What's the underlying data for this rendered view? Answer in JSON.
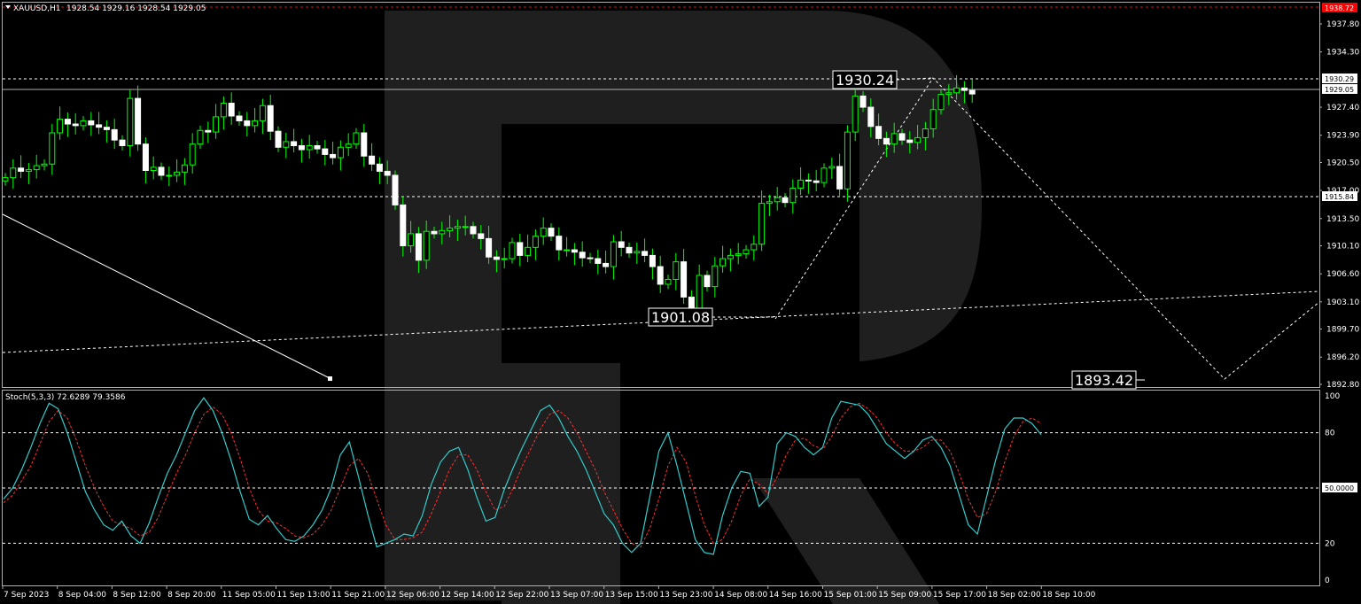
{
  "header": {
    "symbol": "XAUUSD,H1",
    "ohlc": "1928.54 1929.16 1928.54 1929.05"
  },
  "price_levels": {
    "red_line": "1938.72",
    "dotted_upper": "1930.29",
    "current": "1929.05",
    "dotted_mid": "1915.84"
  },
  "annotations": {
    "high_label": "1930.24",
    "low_label": "1901.08",
    "target_label": "1893.42"
  },
  "stoch_panel": {
    "title": "Stoch(5,3,3) 72.6289 79.3586",
    "levels": [
      "100",
      "80",
      "50.0000",
      "20",
      "0"
    ]
  },
  "colors": {
    "bull": "#00ff00",
    "bear_body": "#ffffff",
    "stoch_main": "#33cccc",
    "stoch_signal": "#ff3030",
    "red_line": "#ff0000",
    "watermark": "#2e2e2e"
  },
  "chart_data": [
    {
      "type": "candlestick",
      "title": "XAUUSD,H1",
      "ylim": [
        1892.8,
        1939.9
      ],
      "y_ticks": [
        1937.8,
        1934.3,
        1930.29,
        1929.05,
        1927.4,
        1923.9,
        1920.5,
        1917.0,
        1915.84,
        1913.5,
        1910.1,
        1906.6,
        1903.1,
        1899.7,
        1896.2,
        1892.8
      ],
      "x_tick_labels": [
        "7 Sep 2023",
        "8 Sep 04:00",
        "8 Sep 12:00",
        "8 Sep 20:00",
        "11 Sep 05:00",
        "11 Sep 13:00",
        "11 Sep 21:00",
        "12 Sep 06:00",
        "12 Sep 14:00",
        "12 Sep 22:00",
        "13 Sep 07:00",
        "13 Sep 15:00",
        "13 Sep 23:00",
        "14 Sep 08:00",
        "14 Sep 16:00",
        "15 Sep 01:00",
        "15 Sep 09:00",
        "15 Sep 17:00",
        "18 Sep 02:00",
        "18 Sep 10:00"
      ],
      "close_path": [
        1918.6,
        1919.8,
        1919.4,
        1919.6,
        1920.1,
        1920.3,
        1924.2,
        1925.9,
        1925.3,
        1925.1,
        1925.7,
        1925.2,
        1924.9,
        1924.6,
        1923.3,
        1922.6,
        1928.5,
        1922.8,
        1919.5,
        1919.9,
        1918.9,
        1918.9,
        1919.3,
        1920.2,
        1922.8,
        1924.5,
        1924.3,
        1926.2,
        1927.9,
        1926.3,
        1925.7,
        1925.1,
        1925.7,
        1927.6,
        1924.4,
        1922.4,
        1923.1,
        1922.6,
        1922.1,
        1922.6,
        1922.2,
        1921.5,
        1921.1,
        1922.4,
        1922.8,
        1924.2,
        1921.3,
        1920.3,
        1919.4,
        1918.9,
        1915.2,
        1910.1,
        1911.6,
        1908.3,
        1911.9,
        1911.6,
        1912.0,
        1912.3,
        1912.5,
        1912.5,
        1911.6,
        1911.0,
        1908.7,
        1908.4,
        1908.5,
        1910.5,
        1908.9,
        1909.9,
        1911.3,
        1912.3,
        1911.3,
        1909.6,
        1909.6,
        1909.3,
        1908.6,
        1908.5,
        1907.9,
        1907.5,
        1910.6,
        1909.9,
        1909.2,
        1909.4,
        1908.9,
        1907.5,
        1905.3,
        1905.9,
        1908.1,
        1903.7,
        1901.9,
        1906.4,
        1905.0,
        1907.6,
        1908.5,
        1908.9,
        1909.1,
        1909.6,
        1910.3,
        1915.4,
        1915.6,
        1916.1,
        1915.5,
        1917.3,
        1918.3,
        1918.2,
        1918.0,
        1919.8,
        1920.0,
        1917.2,
        1924.3,
        1928.8,
        1927.4,
        1925.0,
        1923.5,
        1922.8,
        1924.1,
        1923.3,
        1923.0,
        1923.6,
        1924.7,
        1927.1,
        1929.0,
        1929.2,
        1929.8,
        1929.5,
        1929.05
      ]
    },
    {
      "type": "line",
      "title": "Stoch(5,3,3) 72.6289 79.3586",
      "ylim": [
        0,
        100
      ],
      "levels": [
        20,
        50,
        80
      ],
      "series": [
        {
          "name": "Stoch(5,3,3)",
          "values": [
            44,
            50,
            60,
            72,
            85,
            96,
            93,
            80,
            64,
            48,
            38,
            30,
            27,
            32,
            24,
            20,
            31,
            45,
            58,
            68,
            80,
            92,
            99,
            92,
            80,
            65,
            48,
            33,
            30,
            35,
            28,
            22,
            21,
            24,
            30,
            38,
            50,
            68,
            75,
            56,
            36,
            18,
            20,
            22,
            25,
            24,
            35,
            52,
            64,
            70,
            72,
            60,
            45,
            32,
            34,
            49,
            61,
            72,
            82,
            92,
            95,
            88,
            78,
            70,
            60,
            48,
            36,
            30,
            20,
            15,
            20,
            45,
            70,
            80,
            62,
            42,
            22,
            15,
            14,
            35,
            50,
            59,
            58,
            40,
            45,
            74,
            80,
            78,
            72,
            68,
            72,
            88,
            97,
            96,
            95,
            90,
            82,
            74,
            70,
            66,
            70,
            76,
            78,
            72,
            62,
            46,
            30,
            25,
            45,
            65,
            82,
            88,
            88,
            85,
            79
          ]
        },
        {
          "name": "signal",
          "values": [
            42,
            46,
            54,
            62,
            74,
            86,
            92,
            88,
            76,
            62,
            50,
            40,
            32,
            30,
            28,
            24,
            26,
            34,
            46,
            58,
            68,
            80,
            90,
            94,
            90,
            80,
            66,
            50,
            38,
            32,
            31,
            28,
            24,
            23,
            25,
            30,
            38,
            50,
            62,
            66,
            58,
            44,
            30,
            22,
            22,
            23,
            26,
            36,
            48,
            60,
            68,
            68,
            60,
            48,
            38,
            40,
            50,
            62,
            72,
            82,
            90,
            92,
            88,
            80,
            70,
            60,
            48,
            38,
            28,
            20,
            18,
            28,
            44,
            62,
            72,
            64,
            46,
            30,
            20,
            22,
            32,
            46,
            55,
            52,
            47,
            56,
            68,
            76,
            77,
            73,
            71,
            78,
            88,
            94,
            96,
            93,
            88,
            80,
            74,
            70,
            70,
            72,
            76,
            76,
            70,
            58,
            44,
            34,
            36,
            48,
            64,
            78,
            86,
            88,
            85
          ]
        }
      ]
    }
  ]
}
